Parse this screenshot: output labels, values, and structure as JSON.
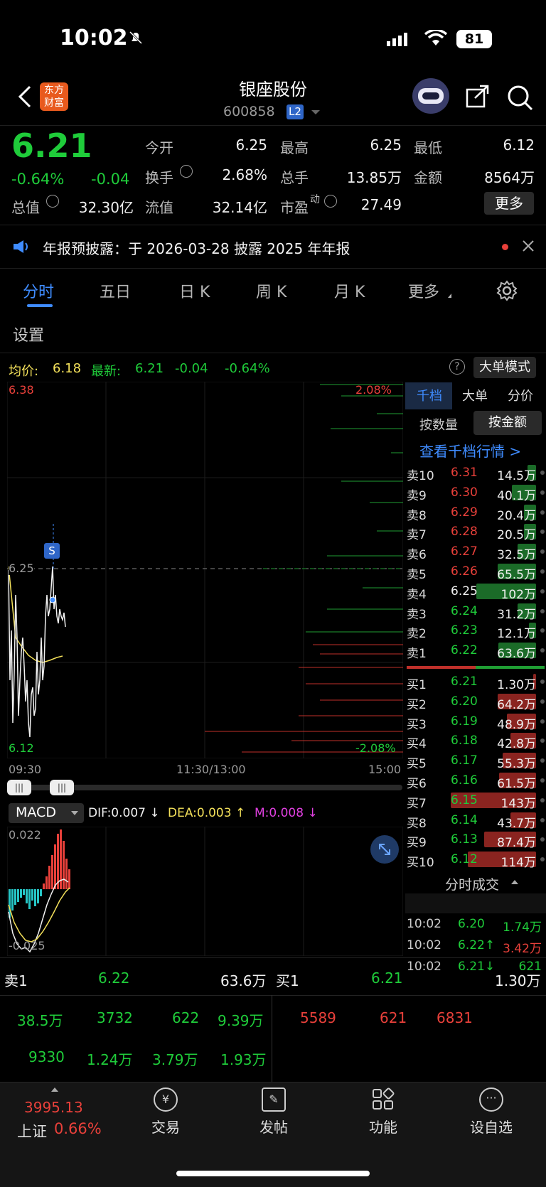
{
  "status": {
    "time": "10:02",
    "battery": "81"
  },
  "header": {
    "title": "银座股份",
    "code": "600858",
    "level_badge": "L2",
    "logo_text_1": "东方",
    "logo_text_2": "财富"
  },
  "quote": {
    "price": "6.21",
    "change_pct": "-0.64%",
    "change": "-0.04",
    "open_label": "今开",
    "open": "6.25",
    "high_label": "最高",
    "high": "6.25",
    "low_label": "最低",
    "low": "6.12",
    "turnover_label": "换手",
    "turnover": "2.68%",
    "volume_label": "总手",
    "volume": "13.85万",
    "amount_label": "金额",
    "amount": "8564万",
    "mktcap_label": "总值",
    "mktcap": "32.30亿",
    "float_label": "流值",
    "float": "32.14亿",
    "pe_label": "市盈",
    "pe_sup": "动",
    "pe": "27.49",
    "more_label": "更多"
  },
  "notice": {
    "text": "年报预披露：于 2026-03-28 披露 2025 年年报"
  },
  "tabs": [
    "分时",
    "五日",
    "日 K",
    "周 K",
    "月 K",
    "更多"
  ],
  "settings_label": "设置",
  "info_line": {
    "avg_label": "均价:",
    "avg": "6.18",
    "latest_label": "最新:",
    "latest": "6.21",
    "chg": "-0.04",
    "pct": "-0.64%",
    "mode_button": "大单模式"
  },
  "chart_labels": {
    "top_price": "6.38",
    "mid_price": "6.25",
    "bottom_price": "6.12",
    "top_pct": "2.08%",
    "bottom_pct": "-2.08%",
    "t_start": "09:30",
    "t_mid": "11:30/13:00",
    "t_end": "15:00",
    "marker": "S"
  },
  "macd": {
    "label": "MACD",
    "dif": "DIF:0.007 ↓",
    "dea": "DEA:0.003 ↑",
    "m": "M:0.008 ↓",
    "top": "0.022",
    "bottom": "-0.025"
  },
  "side": {
    "tabs": [
      "千档",
      "大单",
      "分价"
    ],
    "toggle": [
      "按数量",
      "按金额"
    ],
    "link": "查看千档行情 >",
    "trades_title": "分时成交"
  },
  "orderbook": {
    "asks": [
      {
        "label": "卖10",
        "price": "6.31",
        "vol": "14.5万",
        "pc": "red",
        "fill": 0.1
      },
      {
        "label": "卖9",
        "price": "6.30",
        "vol": "40.1万",
        "pc": "red",
        "fill": 0.28
      },
      {
        "label": "卖8",
        "price": "6.29",
        "vol": "20.4万",
        "pc": "red",
        "fill": 0.14
      },
      {
        "label": "卖7",
        "price": "6.28",
        "vol": "20.5万",
        "pc": "red",
        "fill": 0.14
      },
      {
        "label": "卖6",
        "price": "6.27",
        "vol": "32.5万",
        "pc": "red",
        "fill": 0.22
      },
      {
        "label": "卖5",
        "price": "6.26",
        "vol": "65.5万",
        "pc": "red",
        "fill": 0.45
      },
      {
        "label": "卖4",
        "price": "6.25",
        "vol": "102万",
        "pc": "white",
        "fill": 0.7
      },
      {
        "label": "卖3",
        "price": "6.24",
        "vol": "31.2万",
        "pc": "green",
        "fill": 0.22
      },
      {
        "label": "卖2",
        "price": "6.23",
        "vol": "12.1万",
        "pc": "green",
        "fill": 0.08
      },
      {
        "label": "卖1",
        "price": "6.22",
        "vol": "63.6万",
        "pc": "green",
        "fill": 0.44
      }
    ],
    "bids": [
      {
        "label": "买1",
        "price": "6.21",
        "vol": "1.30万",
        "pc": "green",
        "fill": 0.01
      },
      {
        "label": "买2",
        "price": "6.20",
        "vol": "64.2万",
        "pc": "green",
        "fill": 0.45
      },
      {
        "label": "买3",
        "price": "6.19",
        "vol": "48.9万",
        "pc": "green",
        "fill": 0.34
      },
      {
        "label": "买4",
        "price": "6.18",
        "vol": "42.8万",
        "pc": "green",
        "fill": 0.3
      },
      {
        "label": "买5",
        "price": "6.17",
        "vol": "55.3万",
        "pc": "green",
        "fill": 0.39
      },
      {
        "label": "买6",
        "price": "6.16",
        "vol": "61.5万",
        "pc": "green",
        "fill": 0.43
      },
      {
        "label": "买7",
        "price": "6.15",
        "vol": "143万",
        "pc": "green",
        "fill": 1.0
      },
      {
        "label": "买8",
        "price": "6.14",
        "vol": "43.7万",
        "pc": "green",
        "fill": 0.3
      },
      {
        "label": "买9",
        "price": "6.13",
        "vol": "87.4万",
        "pc": "green",
        "fill": 0.61
      },
      {
        "label": "买10",
        "price": "6.12",
        "vol": "114万",
        "pc": "green",
        "fill": 0.8
      }
    ]
  },
  "trades": [
    {
      "time": "10:02",
      "price": "6.20",
      "vol": "1.74万",
      "pc": "green",
      "vc": "green"
    },
    {
      "time": "10:02",
      "price": "6.22↑",
      "vol": "3.42万",
      "pc": "green",
      "vc": "red"
    },
    {
      "time": "10:02",
      "price": "6.21↓",
      "vol": "621",
      "pc": "green",
      "vc": "green"
    }
  ],
  "bottom": {
    "sell_label": "卖1",
    "sell_price": "6.22",
    "sell_vol": "63.6万",
    "buy_label": "买1",
    "buy_price": "6.21",
    "buy_vol": "1.30万",
    "sell_row1": [
      "38.5万",
      "3732",
      "622",
      "9.39万"
    ],
    "sell_row2": [
      "9330",
      "1.24万",
      "3.79万",
      "1.93万"
    ],
    "buy_row1": [
      "5589",
      "621",
      "6831"
    ]
  },
  "nav": {
    "index_value": "3995.13",
    "index_name": "上证",
    "index_pct": "0.66%",
    "items": [
      "交易",
      "发帖",
      "功能",
      "设自选"
    ]
  }
}
